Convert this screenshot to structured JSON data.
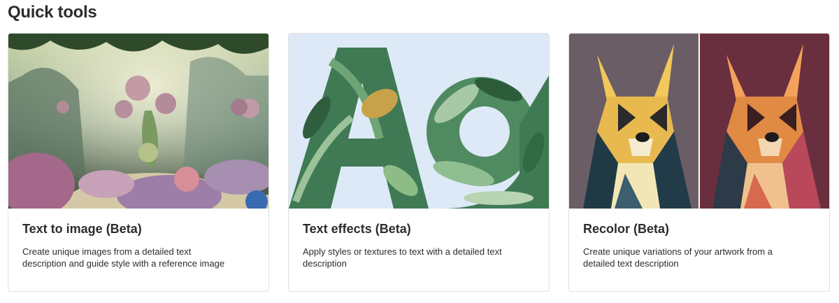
{
  "section": {
    "title": "Quick tools"
  },
  "cards": [
    {
      "title": "Text to image (Beta)",
      "description": "Create unique images from a detailed text description and guide style with a reference image",
      "image": "fantasy-garden-image"
    },
    {
      "title": "Text effects (Beta)",
      "description": "Apply styles or textures to text with a detailed text description",
      "image": "leafy-letters-image"
    },
    {
      "title": "Recolor (Beta)",
      "description": "Create unique variations of your artwork from a detailed text description",
      "image": "geometric-dog-image"
    }
  ],
  "colors": {
    "text": "#2c2c2c",
    "card_border": "#e1e1e1",
    "recolor_left_bg": "#6b5d66",
    "recolor_right_bg": "#6a2f3e",
    "text_effects_bg": "#dde9f6"
  }
}
